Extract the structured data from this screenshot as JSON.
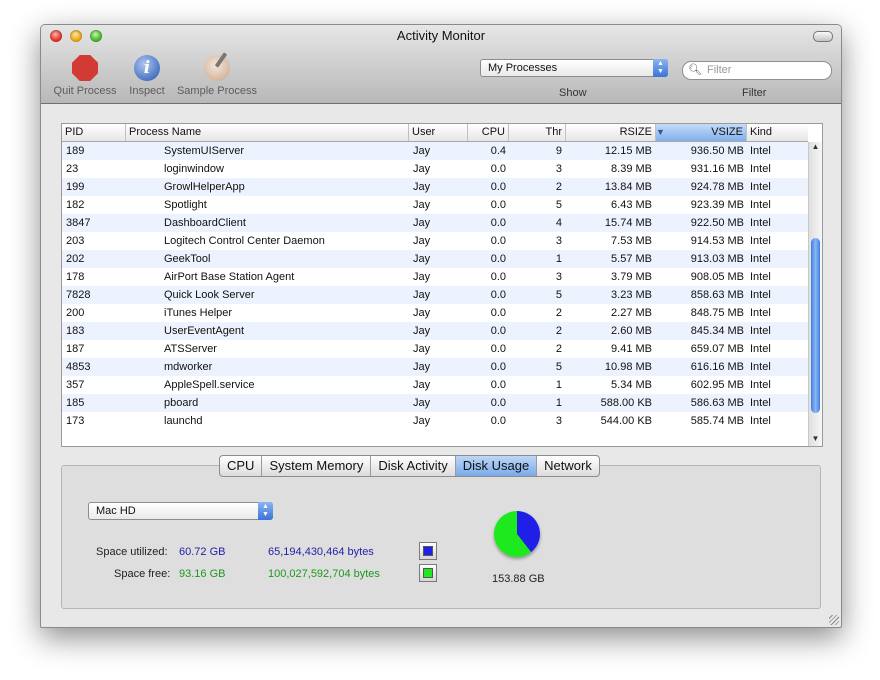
{
  "window": {
    "title": "Activity Monitor"
  },
  "toolbar": {
    "quit_label": "Quit Process",
    "inspect_label": "Inspect",
    "sample_label": "Sample Process",
    "show_value": "My Processes",
    "show_label": "Show",
    "filter_placeholder": "Filter",
    "filter_label": "Filter"
  },
  "table": {
    "columns": [
      "PID",
      "Process Name",
      "User",
      "CPU",
      "Thr",
      "RSIZE",
      "VSIZE",
      "Kind"
    ],
    "sorted_column": "VSIZE",
    "rows": [
      {
        "pid": "189",
        "name": "SystemUIServer",
        "user": "Jay",
        "cpu": "0.4",
        "thr": "9",
        "rsize": "12.15 MB",
        "vsize": "936.50 MB",
        "kind": "Intel"
      },
      {
        "pid": "23",
        "name": "loginwindow",
        "user": "Jay",
        "cpu": "0.0",
        "thr": "3",
        "rsize": "8.39 MB",
        "vsize": "931.16 MB",
        "kind": "Intel"
      },
      {
        "pid": "199",
        "name": "GrowlHelperApp",
        "user": "Jay",
        "cpu": "0.0",
        "thr": "2",
        "rsize": "13.84 MB",
        "vsize": "924.78 MB",
        "kind": "Intel"
      },
      {
        "pid": "182",
        "name": "Spotlight",
        "user": "Jay",
        "cpu": "0.0",
        "thr": "5",
        "rsize": "6.43 MB",
        "vsize": "923.39 MB",
        "kind": "Intel"
      },
      {
        "pid": "3847",
        "name": "DashboardClient",
        "user": "Jay",
        "cpu": "0.0",
        "thr": "4",
        "rsize": "15.74 MB",
        "vsize": "922.50 MB",
        "kind": "Intel"
      },
      {
        "pid": "203",
        "name": "Logitech Control Center Daemon",
        "user": "Jay",
        "cpu": "0.0",
        "thr": "3",
        "rsize": "7.53 MB",
        "vsize": "914.53 MB",
        "kind": "Intel"
      },
      {
        "pid": "202",
        "name": "GeekTool",
        "user": "Jay",
        "cpu": "0.0",
        "thr": "1",
        "rsize": "5.57 MB",
        "vsize": "913.03 MB",
        "kind": "Intel"
      },
      {
        "pid": "178",
        "name": "AirPort Base Station Agent",
        "user": "Jay",
        "cpu": "0.0",
        "thr": "3",
        "rsize": "3.79 MB",
        "vsize": "908.05 MB",
        "kind": "Intel"
      },
      {
        "pid": "7828",
        "name": "Quick Look Server",
        "user": "Jay",
        "cpu": "0.0",
        "thr": "5",
        "rsize": "3.23 MB",
        "vsize": "858.63 MB",
        "kind": "Intel"
      },
      {
        "pid": "200",
        "name": "iTunes Helper",
        "user": "Jay",
        "cpu": "0.0",
        "thr": "2",
        "rsize": "2.27 MB",
        "vsize": "848.75 MB",
        "kind": "Intel"
      },
      {
        "pid": "183",
        "name": "UserEventAgent",
        "user": "Jay",
        "cpu": "0.0",
        "thr": "2",
        "rsize": "2.60 MB",
        "vsize": "845.34 MB",
        "kind": "Intel"
      },
      {
        "pid": "187",
        "name": "ATSServer",
        "user": "Jay",
        "cpu": "0.0",
        "thr": "2",
        "rsize": "9.41 MB",
        "vsize": "659.07 MB",
        "kind": "Intel"
      },
      {
        "pid": "4853",
        "name": "mdworker",
        "user": "Jay",
        "cpu": "0.0",
        "thr": "5",
        "rsize": "10.98 MB",
        "vsize": "616.16 MB",
        "kind": "Intel"
      },
      {
        "pid": "357",
        "name": "AppleSpell.service",
        "user": "Jay",
        "cpu": "0.0",
        "thr": "1",
        "rsize": "5.34 MB",
        "vsize": "602.95 MB",
        "kind": "Intel"
      },
      {
        "pid": "185",
        "name": "pboard",
        "user": "Jay",
        "cpu": "0.0",
        "thr": "1",
        "rsize": "588.00 KB",
        "vsize": "586.63 MB",
        "kind": "Intel"
      },
      {
        "pid": "173",
        "name": "launchd",
        "user": "Jay",
        "cpu": "0.0",
        "thr": "3",
        "rsize": "544.00 KB",
        "vsize": "585.74 MB",
        "kind": "Intel"
      }
    ]
  },
  "tabs": [
    {
      "label": "CPU",
      "active": false
    },
    {
      "label": "System Memory",
      "active": false
    },
    {
      "label": "Disk Activity",
      "active": false
    },
    {
      "label": "Disk Usage",
      "active": true
    },
    {
      "label": "Network",
      "active": false
    }
  ],
  "disk_usage": {
    "disk_value": "Mac HD",
    "utilized_label": "Space utilized:",
    "utilized_gb": "60.72 GB",
    "utilized_bytes": "65,194,430,464 bytes",
    "free_label": "Space free:",
    "free_gb": "93.16 GB",
    "free_bytes": "100,027,592,704 bytes",
    "total": "153.88 GB",
    "utilized_fraction": 0.3946,
    "utilized_color": "#1f1fe8",
    "free_color": "#1ee81e"
  }
}
